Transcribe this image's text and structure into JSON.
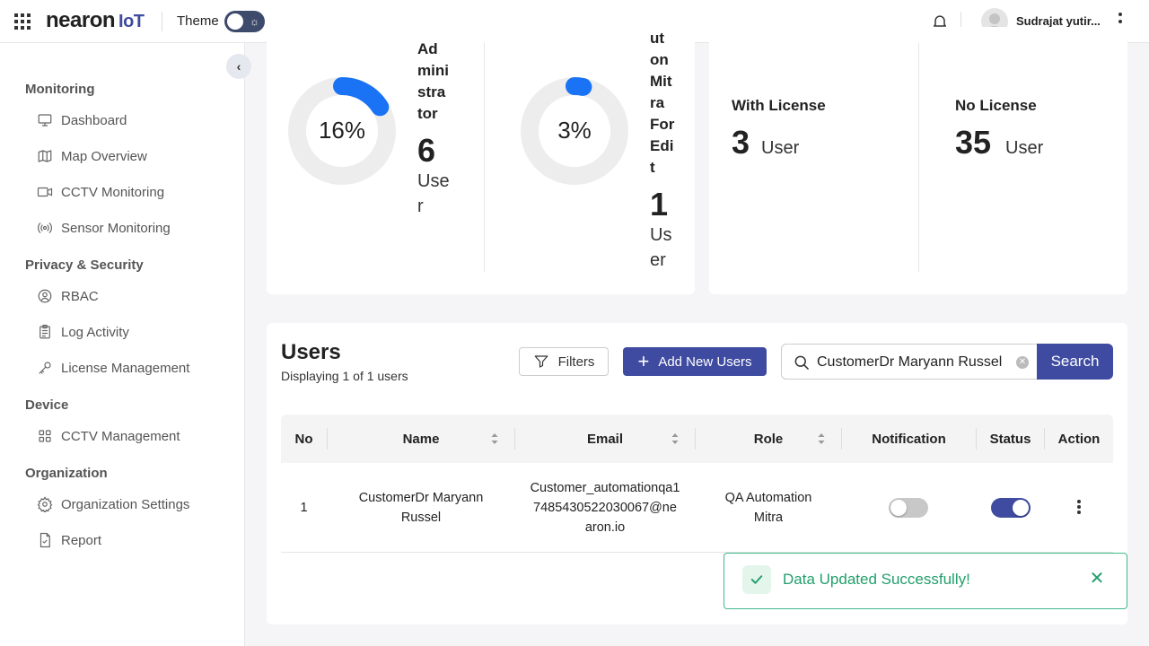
{
  "header": {
    "brand_main": "nearon",
    "brand_suffix": "IoT",
    "theme_label": "Theme",
    "username": "Sudrajat yutir..."
  },
  "sidebar": {
    "sections": [
      {
        "title": "Monitoring",
        "items": [
          {
            "label": "Dashboard",
            "icon": "monitor-icon"
          },
          {
            "label": "Map Overview",
            "icon": "map-icon"
          },
          {
            "label": "CCTV Monitoring",
            "icon": "video-icon"
          },
          {
            "label": "Sensor Monitoring",
            "icon": "sensor-icon"
          }
        ]
      },
      {
        "title": "Privacy & Security",
        "items": [
          {
            "label": "RBAC",
            "icon": "rbac-icon"
          },
          {
            "label": "Log Activity",
            "icon": "clipboard-icon"
          },
          {
            "label": "License Management",
            "icon": "key-icon"
          }
        ]
      },
      {
        "title": "Device",
        "items": [
          {
            "label": "CCTV Management",
            "icon": "grid-icon"
          }
        ]
      },
      {
        "title": "Organization",
        "items": [
          {
            "label": "Organization Settings",
            "icon": "gear-icon"
          },
          {
            "label": "Report",
            "icon": "file-icon"
          }
        ]
      }
    ]
  },
  "stats": {
    "role1": {
      "percent": 16,
      "percent_label": "16%",
      "name_lines": [
        "Ad",
        "mini",
        "stra",
        "tor"
      ],
      "count": "6",
      "unit_lines": [
        "Use",
        "r"
      ]
    },
    "role2": {
      "percent": 3,
      "percent_label": "3%",
      "name_lines": [
        "on",
        "Mit",
        "ra",
        "For",
        "Edi",
        "t"
      ],
      "name_partial_top": "ut",
      "count": "1",
      "unit_lines": [
        "Us",
        "er"
      ]
    },
    "with_license": {
      "title": "With License",
      "count": "3",
      "unit": "User"
    },
    "no_license": {
      "title": "No License",
      "count": "35",
      "unit": "User"
    }
  },
  "users": {
    "title": "Users",
    "subtitle": "Displaying 1 of 1 users",
    "filters_label": "Filters",
    "add_label": "Add New Users",
    "search_value": "CustomerDr Maryann Russel",
    "search_button": "Search",
    "columns": [
      "No",
      "Name",
      "Email",
      "Role",
      "Notification",
      "Status",
      "Action"
    ],
    "rows": [
      {
        "no": "1",
        "name_lines": [
          "CustomerDr Maryann",
          "Russel"
        ],
        "email_lines": [
          "Customer_automationqa1",
          "7485430522030067@ne",
          "aron.io"
        ],
        "role_lines": [
          "QA Automation",
          "Mitra"
        ],
        "notification": false,
        "status": true
      }
    ]
  },
  "toast": {
    "message": "Data Updated Successfully!"
  },
  "colors": {
    "primary": "#3f4ba0",
    "donut_accent": "#1a73f5",
    "success": "#22a06b"
  }
}
